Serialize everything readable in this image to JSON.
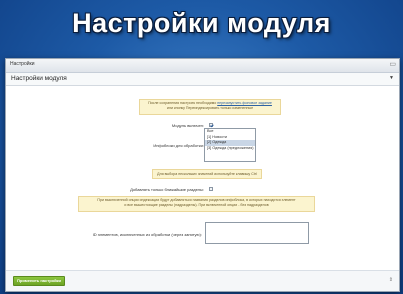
{
  "banner": {
    "title": "Настройки модуля"
  },
  "window": {
    "tab_label": "Настройки",
    "section_title": "Настройки модуля",
    "note_top": {
      "line1_prefix": "После сохранения настроек необходимо ",
      "line1_link": "перезапустить фоновое задание",
      "line2": "или кнопку Переиндексировать только измененные"
    },
    "module_enabled_label": "Модуль включен:",
    "infoblocks_label": "Инфоблоки для обработки:",
    "infoblocks_options": [
      "Все",
      "[1] Новости",
      "[2] Одежда",
      "[3] Одежда (предложения)"
    ],
    "infoblocks_selected_index": 2,
    "note_multi": "Для выбора нескольких значений используйте клавишу Ctrl",
    "bottom_sections_label": "Добавлять только ближайшие разделы:",
    "note_long": {
      "line1": "При выключенной опции индексации будут добавляться названия разделов инфоблока, в которых находится элемент",
      "line2": "и все вышестоящие разделы (надразделы). При включенной опции - без надразделов"
    },
    "exclude_ids_label": "ID элементов, исключенных из обработки (через запятую):",
    "apply_button": "Применить настройки"
  }
}
